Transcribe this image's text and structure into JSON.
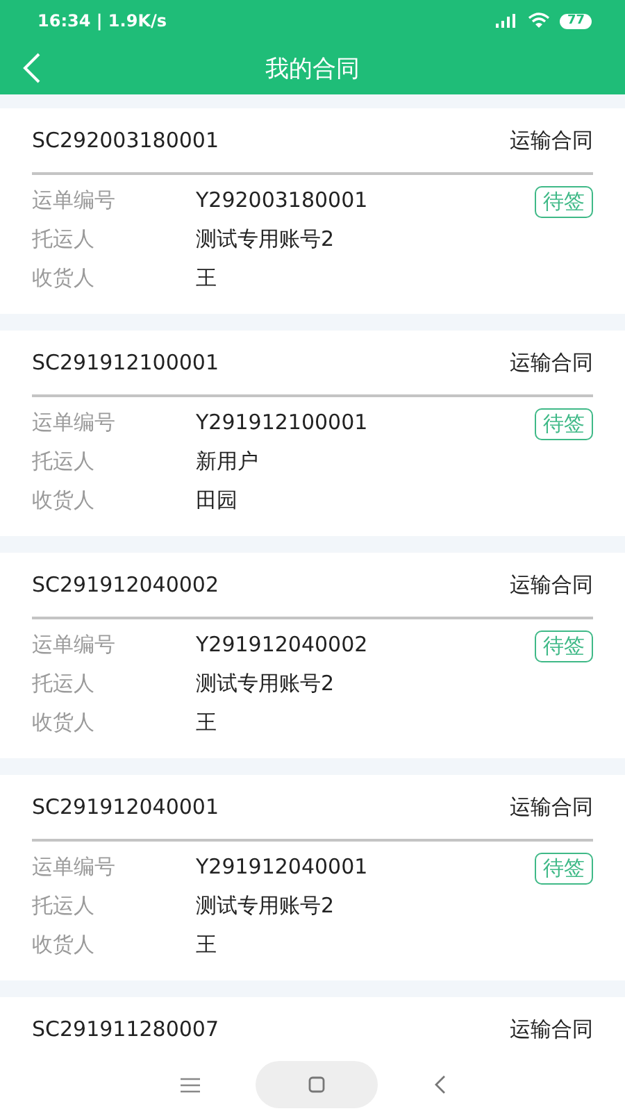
{
  "status_bar": {
    "time": "16:34 | 1.9K/s",
    "battery": "77"
  },
  "header": {
    "title": "我的合同"
  },
  "contracts": [
    {
      "number": "SC292003180001",
      "type": "运输合同",
      "status": "待签",
      "fields": [
        {
          "label": "运单编号",
          "value": "Y292003180001"
        },
        {
          "label": "托运人",
          "value": "测试专用账号2"
        },
        {
          "label": "收货人",
          "value": "王"
        }
      ]
    },
    {
      "number": "SC291912100001",
      "type": "运输合同",
      "status": "待签",
      "fields": [
        {
          "label": "运单编号",
          "value": "Y291912100001"
        },
        {
          "label": "托运人",
          "value": "新用户"
        },
        {
          "label": "收货人",
          "value": "田园"
        }
      ]
    },
    {
      "number": "SC291912040002",
      "type": "运输合同",
      "status": "待签",
      "fields": [
        {
          "label": "运单编号",
          "value": "Y291912040002"
        },
        {
          "label": "托运人",
          "value": "测试专用账号2"
        },
        {
          "label": "收货人",
          "value": "王"
        }
      ]
    },
    {
      "number": "SC291912040001",
      "type": "运输合同",
      "status": "待签",
      "fields": [
        {
          "label": "运单编号",
          "value": "Y291912040001"
        },
        {
          "label": "托运人",
          "value": "测试专用账号2"
        },
        {
          "label": "收货人",
          "value": "王"
        }
      ]
    },
    {
      "number": "SC291911280007",
      "type": "运输合同"
    }
  ]
}
